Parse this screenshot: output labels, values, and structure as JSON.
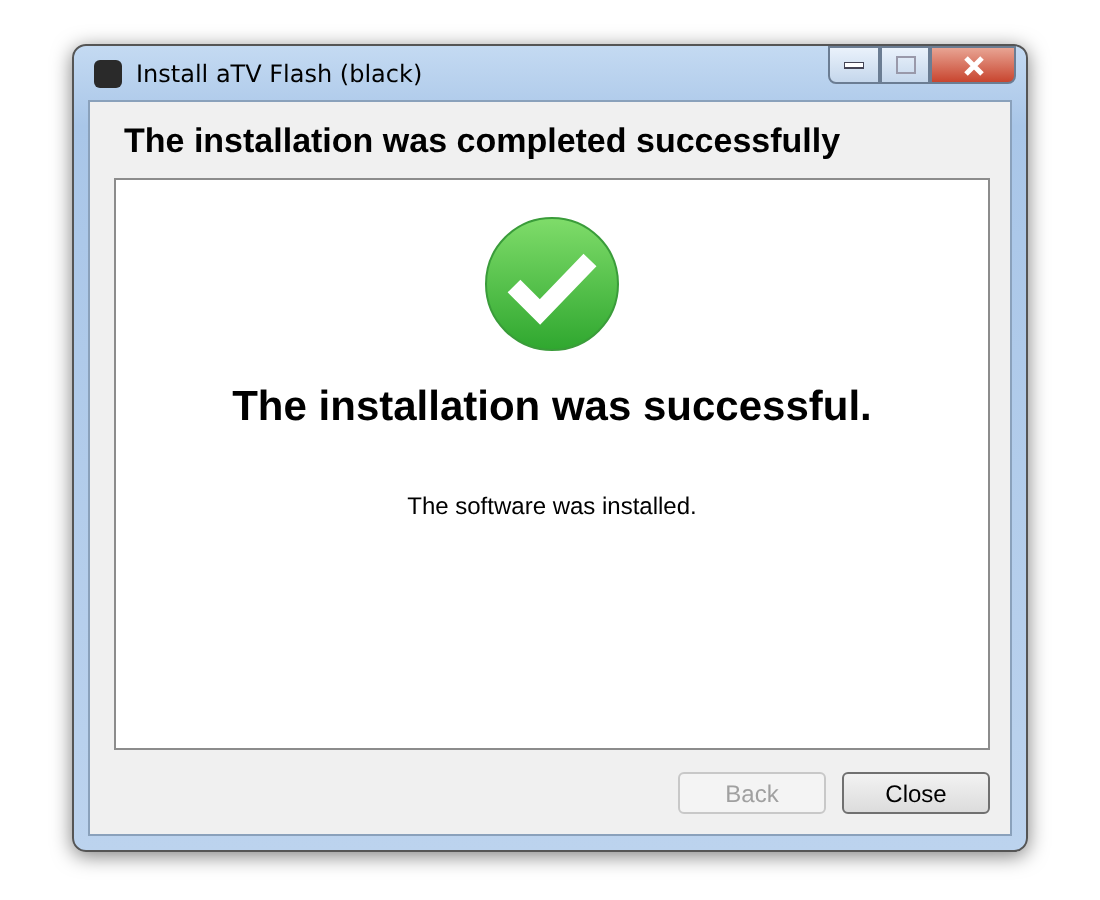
{
  "window": {
    "title": "Install aTV Flash (black)"
  },
  "header": "The installation was completed successfully",
  "result": {
    "title": "The installation was successful.",
    "message": "The software was installed."
  },
  "buttons": [
    {
      "label": "Back",
      "disabled": true
    },
    {
      "label": "Close",
      "disabled": false
    }
  ]
}
